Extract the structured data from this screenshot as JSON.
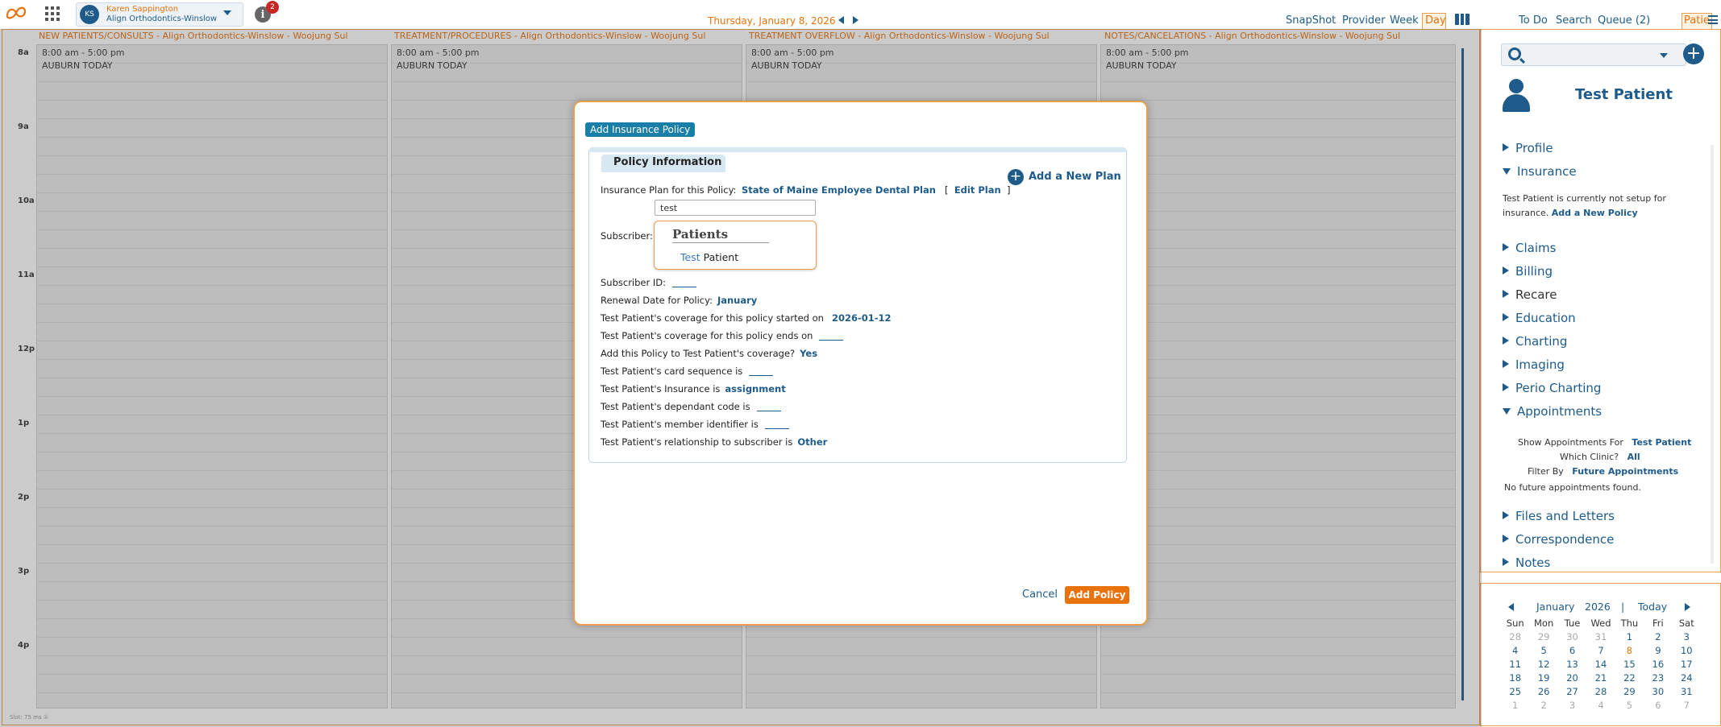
{
  "topbar": {
    "user_initials": "KS",
    "user_name": "Karen Sappington",
    "user_clinic": "Align Orthodontics-Winslow",
    "notification_count": "2",
    "date": "Thursday, January 8, 2026",
    "views": {
      "snapshot": "SnapShot",
      "provider": "Provider",
      "week": "Week",
      "day": "Day"
    },
    "right_links": {
      "todo": "To Do",
      "search": "Search",
      "queue": "Queue (2)",
      "patient_tab": "Patie.."
    }
  },
  "schedule": {
    "times": [
      "8a",
      "9a",
      "10a",
      "11a",
      "12p",
      "1p",
      "2p",
      "3p",
      "4p"
    ],
    "columns": [
      {
        "title": "NEW PATIENTS/CONSULTS - Align Orthodontics-Winslow - Woojung Sul",
        "hours": "8:00 am - 5:00 pm",
        "place": "AUBURN TODAY"
      },
      {
        "title": "TREATMENT/PROCEDURES - Align Orthodontics-Winslow - Woojung Sul",
        "hours": "8:00 am - 5:00 pm",
        "place": "AUBURN TODAY"
      },
      {
        "title": "TREATMENT OVERFLOW - Align Orthodontics-Winslow - Woojung Sul",
        "hours": "8:00 am - 5:00 pm",
        "place": "AUBURN TODAY"
      },
      {
        "title": "NOTES/CANCELATIONS - Align Orthodontics-Winslow - Woojung Sul",
        "hours": "8:00 am - 5:00 pm",
        "place": "AUBURN TODAY"
      }
    ],
    "status": "Slot: 75 ms ①"
  },
  "right_panel": {
    "patient_name": "Test Patient",
    "menu": {
      "profile": "Profile",
      "insurance": "Insurance",
      "claims": "Claims",
      "billing": "Billing",
      "recare": "Recare",
      "education": "Education",
      "charting": "Charting",
      "imaging": "Imaging",
      "perio_charting": "Perio Charting",
      "appointments": "Appointments",
      "files_and_letters": "Files and Letters",
      "correspondence": "Correspondence",
      "notes": "Notes"
    },
    "insurance_note": "Test Patient is currently not setup for insurance.",
    "insurance_add_link": "Add a New Policy",
    "appointments": {
      "show_for_label": "Show Appointments For",
      "show_for_value": "Test Patient",
      "clinic_label": "Which Clinic?",
      "clinic_value": "All",
      "filter_label": "Filter By",
      "filter_value": "Future Appointments",
      "empty": "No future appointments found."
    }
  },
  "mini_calendar": {
    "month": "January",
    "year": "2026",
    "separator": "|",
    "today": "Today",
    "dow": [
      "Sun",
      "Mon",
      "Tue",
      "Wed",
      "Thu",
      "Fri",
      "Sat"
    ],
    "weeks": [
      [
        "28",
        "29",
        "30",
        "31",
        "1",
        "2",
        "3"
      ],
      [
        "4",
        "5",
        "6",
        "7",
        "8",
        "9",
        "10"
      ],
      [
        "11",
        "12",
        "13",
        "14",
        "15",
        "16",
        "17"
      ],
      [
        "18",
        "19",
        "20",
        "21",
        "22",
        "23",
        "24"
      ],
      [
        "25",
        "26",
        "27",
        "28",
        "29",
        "30",
        "31"
      ],
      [
        "1",
        "2",
        "3",
        "4",
        "5",
        "6",
        "7"
      ]
    ]
  },
  "modal": {
    "title": "Add Insurance Policy",
    "section_tab": "Policy Information",
    "add_plan": "Add a New Plan",
    "plan_label": "Insurance Plan for this Policy:",
    "plan_value": "State of Maine Employee Dental Plan",
    "edit_plan_open": "[",
    "edit_plan": "Edit Plan",
    "edit_plan_close": "]",
    "subscriber_input_value": "test",
    "subscriber_label": "Subscriber:",
    "autocomplete": {
      "heading": "Patients",
      "match": "Test",
      "rest": " Patient"
    },
    "fields": [
      {
        "label": "Subscriber ID:",
        "value": ""
      },
      {
        "label": "Renewal Date for Policy:",
        "value": "January"
      },
      {
        "label": "Test Patient's coverage for this policy started on",
        "value": "2026-01-12"
      },
      {
        "label": "Test Patient's coverage for this policy ends on",
        "value": ""
      },
      {
        "label": "Add this Policy to Test Patient's coverage?",
        "value": "Yes"
      },
      {
        "label": "Test Patient's card sequence is",
        "value": ""
      },
      {
        "label": "Test Patient's Insurance is",
        "value": "assignment"
      },
      {
        "label": "Test Patient's dependant code is",
        "value": ""
      },
      {
        "label": "Test Patient's member identifier is",
        "value": ""
      },
      {
        "label": "Test Patient's relationship to subscriber is",
        "value": "Other"
      }
    ],
    "cancel": "Cancel",
    "submit": "Add Policy"
  }
}
